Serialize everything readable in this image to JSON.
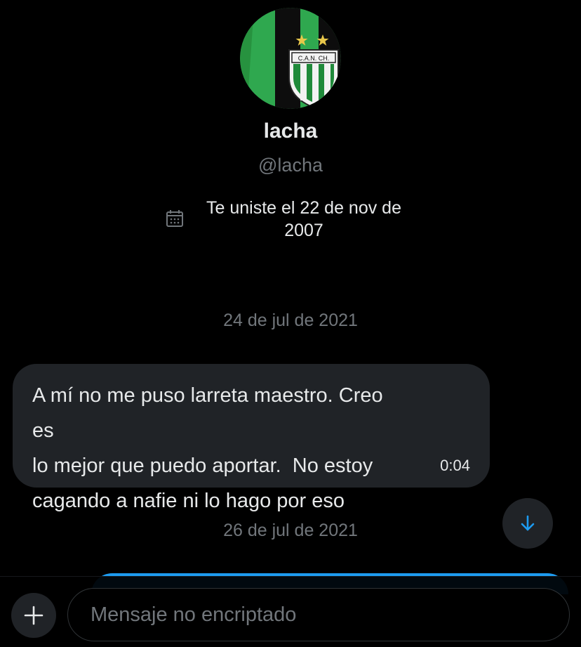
{
  "profile": {
    "display_name": "lacha",
    "handle": "@lacha",
    "avatar_badge_text": "C.A.N. CH.",
    "avatar_icon": "club-crest-avatar",
    "joined_text": "Te uniste el 22 de nov de 2007",
    "joined_icon": "calendar-icon"
  },
  "conversation": {
    "date_separators": [
      "24 de jul de 2021",
      "26 de jul de 2021"
    ],
    "messages": [
      {
        "direction": "received",
        "text": "A mí no me puso larreta maestro. Creo es\nlo mejor que puedo aportar.  No estoy\ncagando a nafie ni lo hago por eso",
        "time": "0:04"
      }
    ],
    "scroll_down_icon": "arrow-down-icon"
  },
  "composer": {
    "add_icon": "plus-icon",
    "placeholder": "Mensaje no encriptado",
    "value": ""
  },
  "colors": {
    "background": "#000000",
    "bubble_received": "#202327",
    "bubble_sent": "#1d9bf0",
    "text_primary": "#e7e9ea",
    "text_secondary": "#71767b",
    "accent": "#1d9bf0",
    "avatar_green": "#2fa84f"
  }
}
